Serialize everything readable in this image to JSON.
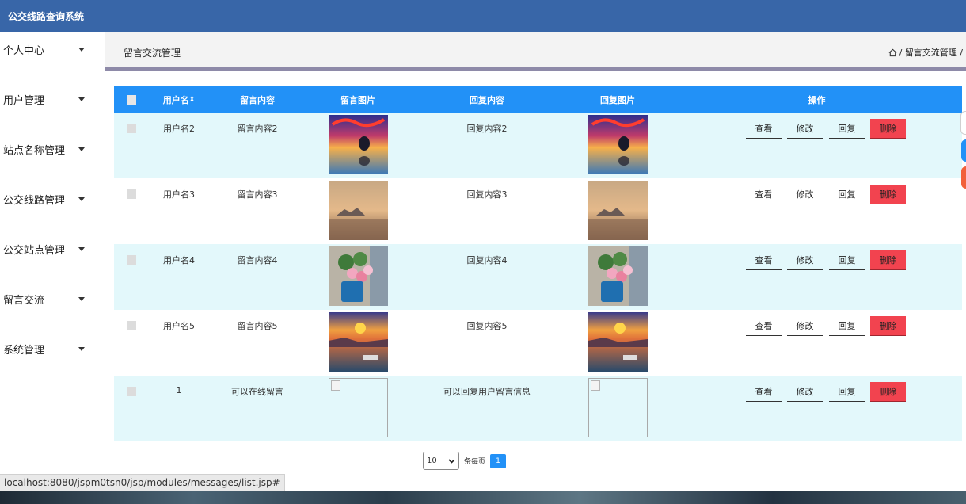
{
  "app_title": "公交线路查询系统",
  "sidebar": {
    "items": [
      {
        "label": "个人中心"
      },
      {
        "label": "用户管理"
      },
      {
        "label": "站点名称管理"
      },
      {
        "label": "公交线路管理"
      },
      {
        "label": "公交站点管理"
      },
      {
        "label": "留言交流"
      },
      {
        "label": "系统管理"
      }
    ]
  },
  "page": {
    "title": "留言交流管理",
    "breadcrumb": "/ 留言交流管理 /"
  },
  "table": {
    "headers": {
      "username": "用户名",
      "content": "留言内容",
      "image": "留言图片",
      "reply": "回复内容",
      "reply_image": "回复图片",
      "actions": "操作"
    },
    "sort_icon": "⇕",
    "rows": [
      {
        "username": "用户名2",
        "content": "留言内容2",
        "reply": "回复内容2",
        "image": "sunset-dolphin"
      },
      {
        "username": "用户名3",
        "content": "留言内容3",
        "reply": "回复内容3",
        "image": "foggy-sunset"
      },
      {
        "username": "用户名4",
        "content": "留言内容4",
        "reply": "回复内容4",
        "image": "flower-bucket"
      },
      {
        "username": "用户名5",
        "content": "留言内容5",
        "reply": "回复内容5",
        "image": "harbor-sunset"
      },
      {
        "username": "1",
        "content": "可以在线留言",
        "reply": "可以回复用户留言信息",
        "image": "broken"
      }
    ],
    "actions": {
      "view": "查看",
      "edit": "修改",
      "reply": "回复",
      "delete": "删除"
    }
  },
  "pager": {
    "page_size": "10",
    "per_page_label": "条每页",
    "current_page": "1"
  },
  "status_url": "localhost:8080/jspm0tsn0/jsp/modules/messages/list.jsp#",
  "colors": {
    "header": "#3866a8",
    "table_head": "#2291f7",
    "row_alt": "#e3f8fb",
    "delete": "#f2434f"
  }
}
